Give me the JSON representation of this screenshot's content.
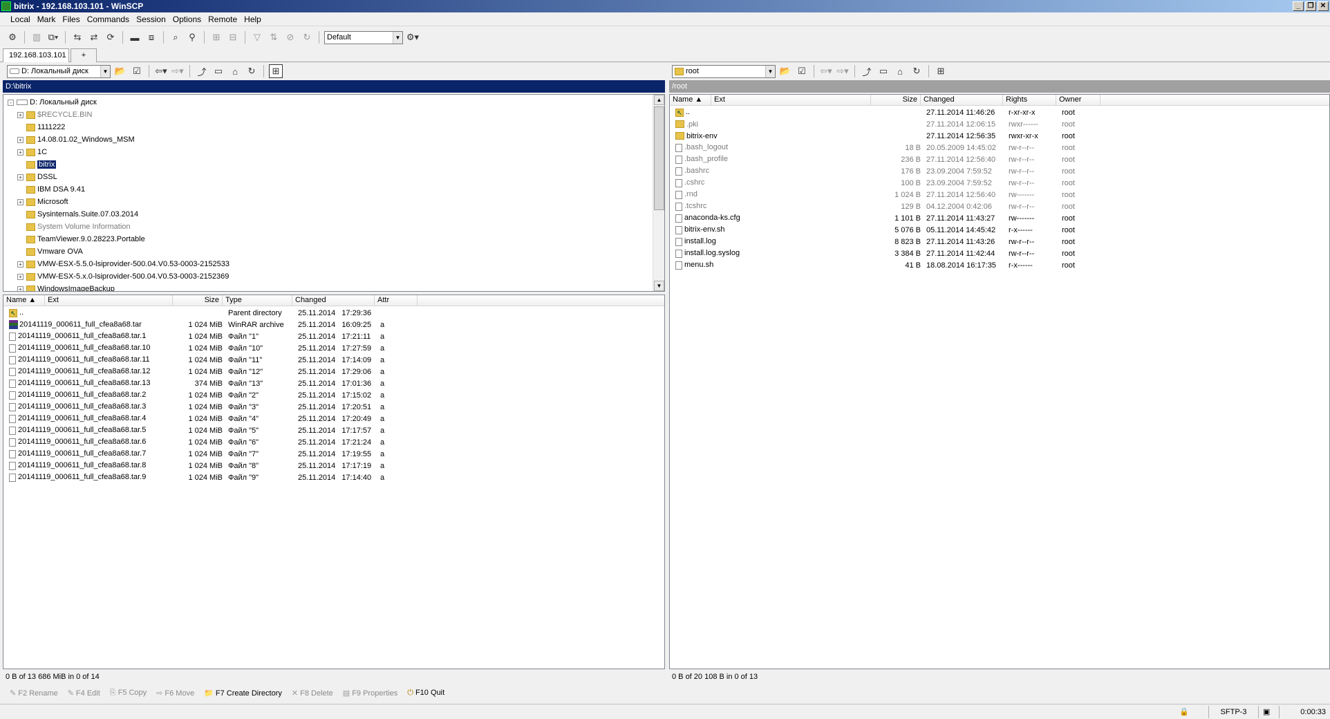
{
  "window": {
    "title": "bitrix - 192.168.103.101 - WinSCP"
  },
  "menu": [
    "Local",
    "Mark",
    "Files",
    "Commands",
    "Session",
    "Options",
    "Remote",
    "Help"
  ],
  "toolbar": {
    "transfer_preset": "Default"
  },
  "tabs": [
    {
      "label": "192.168.103.101"
    },
    {
      "label": "+"
    }
  ],
  "local": {
    "drive": "D: Локальный диск",
    "path": "D:\\bitrix",
    "tree": [
      {
        "label": "D: Локальный диск",
        "level": 0,
        "expander": "-"
      },
      {
        "label": "$RECYCLE.BIN",
        "level": 1,
        "expander": "+",
        "dim": true
      },
      {
        "label": "1111222",
        "level": 1,
        "expander": ""
      },
      {
        "label": "14.08.01.02_Windows_MSM",
        "level": 1,
        "expander": "+"
      },
      {
        "label": "1C",
        "level": 1,
        "expander": "+"
      },
      {
        "label": "bitrix",
        "level": 1,
        "expander": "",
        "selected": true
      },
      {
        "label": "DSSL",
        "level": 1,
        "expander": "+"
      },
      {
        "label": "IBM DSA 9.41",
        "level": 1,
        "expander": ""
      },
      {
        "label": "Microsoft",
        "level": 1,
        "expander": "+"
      },
      {
        "label": "Sysinternals.Suite.07.03.2014",
        "level": 1,
        "expander": ""
      },
      {
        "label": "System Volume Information",
        "level": 1,
        "expander": "",
        "dim": true
      },
      {
        "label": "TeamViewer.9.0.28223.Portable",
        "level": 1,
        "expander": ""
      },
      {
        "label": "Vmware OVA",
        "level": 1,
        "expander": ""
      },
      {
        "label": "VMW-ESX-5.5.0-lsiprovider-500.04.V0.53-0003-2152533",
        "level": 1,
        "expander": "+"
      },
      {
        "label": "VMW-ESX-5.x.0-lsiprovider-500.04.V0.53-0003-2152369",
        "level": 1,
        "expander": "+"
      },
      {
        "label": "WindowsImageBackup",
        "level": 1,
        "expander": "+"
      }
    ],
    "columns": [
      "Name",
      "Ext",
      "Size",
      "Type",
      "Changed",
      "Attr"
    ],
    "files": [
      {
        "name": "..",
        "size": "",
        "type": "Parent directory",
        "date": "25.11.2014",
        "time": "17:29:36",
        "attr": "",
        "icon": "up"
      },
      {
        "name": "20141119_000611_full_cfea8a68.tar",
        "size": "1 024 MiB",
        "type": "WinRAR archive",
        "date": "25.11.2014",
        "time": "16:09:25",
        "attr": "a",
        "icon": "rar"
      },
      {
        "name": "20141119_000611_full_cfea8a68.tar.1",
        "size": "1 024 MiB",
        "type": "Файл \"1\"",
        "date": "25.11.2014",
        "time": "17:21:11",
        "attr": "a",
        "icon": "file"
      },
      {
        "name": "20141119_000611_full_cfea8a68.tar.10",
        "size": "1 024 MiB",
        "type": "Файл \"10\"",
        "date": "25.11.2014",
        "time": "17:27:59",
        "attr": "a",
        "icon": "file"
      },
      {
        "name": "20141119_000611_full_cfea8a68.tar.11",
        "size": "1 024 MiB",
        "type": "Файл \"11\"",
        "date": "25.11.2014",
        "time": "17:14:09",
        "attr": "a",
        "icon": "file"
      },
      {
        "name": "20141119_000611_full_cfea8a68.tar.12",
        "size": "1 024 MiB",
        "type": "Файл \"12\"",
        "date": "25.11.2014",
        "time": "17:29:06",
        "attr": "a",
        "icon": "file"
      },
      {
        "name": "20141119_000611_full_cfea8a68.tar.13",
        "size": "374 MiB",
        "type": "Файл \"13\"",
        "date": "25.11.2014",
        "time": "17:01:36",
        "attr": "a",
        "icon": "file"
      },
      {
        "name": "20141119_000611_full_cfea8a68.tar.2",
        "size": "1 024 MiB",
        "type": "Файл \"2\"",
        "date": "25.11.2014",
        "time": "17:15:02",
        "attr": "a",
        "icon": "file"
      },
      {
        "name": "20141119_000611_full_cfea8a68.tar.3",
        "size": "1 024 MiB",
        "type": "Файл \"3\"",
        "date": "25.11.2014",
        "time": "17:20:51",
        "attr": "a",
        "icon": "file"
      },
      {
        "name": "20141119_000611_full_cfea8a68.tar.4",
        "size": "1 024 MiB",
        "type": "Файл \"4\"",
        "date": "25.11.2014",
        "time": "17:20:49",
        "attr": "a",
        "icon": "file"
      },
      {
        "name": "20141119_000611_full_cfea8a68.tar.5",
        "size": "1 024 MiB",
        "type": "Файл \"5\"",
        "date": "25.11.2014",
        "time": "17:17:57",
        "attr": "a",
        "icon": "file"
      },
      {
        "name": "20141119_000611_full_cfea8a68.tar.6",
        "size": "1 024 MiB",
        "type": "Файл \"6\"",
        "date": "25.11.2014",
        "time": "17:21:24",
        "attr": "a",
        "icon": "file"
      },
      {
        "name": "20141119_000611_full_cfea8a68.tar.7",
        "size": "1 024 MiB",
        "type": "Файл \"7\"",
        "date": "25.11.2014",
        "time": "17:19:55",
        "attr": "a",
        "icon": "file"
      },
      {
        "name": "20141119_000611_full_cfea8a68.tar.8",
        "size": "1 024 MiB",
        "type": "Файл \"8\"",
        "date": "25.11.2014",
        "time": "17:17:19",
        "attr": "a",
        "icon": "file"
      },
      {
        "name": "20141119_000611_full_cfea8a68.tar.9",
        "size": "1 024 MiB",
        "type": "Файл \"9\"",
        "date": "25.11.2014",
        "time": "17:14:40",
        "attr": "a",
        "icon": "file"
      }
    ],
    "status": "0 B of 13 686 MiB in 0 of 14"
  },
  "remote": {
    "folder": "root",
    "path": "/root",
    "columns": [
      "Name",
      "Ext",
      "Size",
      "Changed",
      "Rights",
      "Owner"
    ],
    "files": [
      {
        "name": "..",
        "size": "",
        "changed": "27.11.2014 11:46:26",
        "rights": "r-xr-xr-x",
        "owner": "root",
        "icon": "up",
        "dim": false
      },
      {
        "name": ".pki",
        "size": "",
        "changed": "27.11.2014 12:06:15",
        "rights": "rwxr------",
        "owner": "root",
        "icon": "dir",
        "dim": true
      },
      {
        "name": "bitrix-env",
        "size": "",
        "changed": "27.11.2014 12:56:35",
        "rights": "rwxr-xr-x",
        "owner": "root",
        "icon": "dir",
        "dim": false
      },
      {
        "name": ".bash_logout",
        "size": "18 B",
        "changed": "20.05.2009 14:45:02",
        "rights": "rw-r--r--",
        "owner": "root",
        "icon": "file",
        "dim": true
      },
      {
        "name": ".bash_profile",
        "size": "236 B",
        "changed": "27.11.2014 12:56:40",
        "rights": "rw-r--r--",
        "owner": "root",
        "icon": "file",
        "dim": true
      },
      {
        "name": ".bashrc",
        "size": "176 B",
        "changed": "23.09.2004 7:59:52",
        "rights": "rw-r--r--",
        "owner": "root",
        "icon": "file",
        "dim": true
      },
      {
        "name": ".cshrc",
        "size": "100 B",
        "changed": "23.09.2004 7:59:52",
        "rights": "rw-r--r--",
        "owner": "root",
        "icon": "file",
        "dim": true
      },
      {
        "name": ".rnd",
        "size": "1 024 B",
        "changed": "27.11.2014 12:56:40",
        "rights": "rw-------",
        "owner": "root",
        "icon": "file",
        "dim": true
      },
      {
        "name": ".tcshrc",
        "size": "129 B",
        "changed": "04.12.2004 0:42:06",
        "rights": "rw-r--r--",
        "owner": "root",
        "icon": "file",
        "dim": true
      },
      {
        "name": "anaconda-ks.cfg",
        "size": "1 101 B",
        "changed": "27.11.2014 11:43:27",
        "rights": "rw-------",
        "owner": "root",
        "icon": "file",
        "dim": false
      },
      {
        "name": "bitrix-env.sh",
        "size": "5 076 B",
        "changed": "05.11.2014 14:45:42",
        "rights": "r-x------",
        "owner": "root",
        "icon": "file",
        "dim": false
      },
      {
        "name": "install.log",
        "size": "8 823 B",
        "changed": "27.11.2014 11:43:26",
        "rights": "rw-r--r--",
        "owner": "root",
        "icon": "file",
        "dim": false
      },
      {
        "name": "install.log.syslog",
        "size": "3 384 B",
        "changed": "27.11.2014 11:42:44",
        "rights": "rw-r--r--",
        "owner": "root",
        "icon": "file",
        "dim": false
      },
      {
        "name": "menu.sh",
        "size": "41 B",
        "changed": "18.08.2014 16:17:35",
        "rights": "r-x------",
        "owner": "root",
        "icon": "file",
        "dim": false
      }
    ],
    "status": "0 B of 20 108 B in 0 of 13"
  },
  "fkeys": [
    {
      "label": "F2 Rename",
      "enabled": false,
      "icon": "pencil-icon",
      "glyph": "✎"
    },
    {
      "label": "F4 Edit",
      "enabled": false,
      "icon": "edit-icon",
      "glyph": "✎"
    },
    {
      "label": "F5 Copy",
      "enabled": false,
      "icon": "copy-icon",
      "glyph": "⎘"
    },
    {
      "label": "F6 Move",
      "enabled": false,
      "icon": "move-icon",
      "glyph": "⇨"
    },
    {
      "label": "F7 Create Directory",
      "enabled": true,
      "icon": "new-folder-icon",
      "glyph": "📁"
    },
    {
      "label": "F8 Delete",
      "enabled": false,
      "icon": "delete-icon",
      "glyph": "✕"
    },
    {
      "label": "F9 Properties",
      "enabled": false,
      "icon": "properties-icon",
      "glyph": "▤"
    },
    {
      "label": "F10 Quit",
      "enabled": true,
      "icon": "quit-icon",
      "glyph": "⏻"
    }
  ],
  "statusbar": {
    "protocol": "SFTP-3",
    "elapsed": "0:00:33"
  },
  "colors": {
    "local_path_bg": "#0a246a",
    "remote_path_bg": "#a0a0a0",
    "selection": "#0a246a"
  }
}
